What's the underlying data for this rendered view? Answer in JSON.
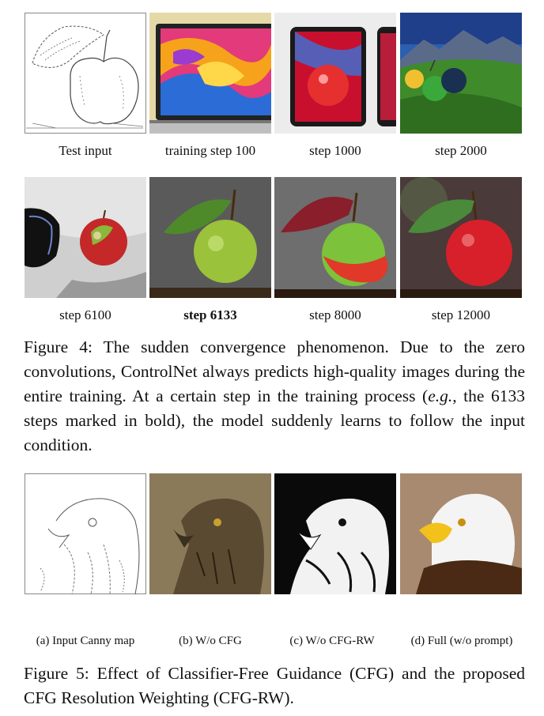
{
  "figure4": {
    "labels": [
      "Test input",
      "training step 100",
      "step 1000",
      "step 2000",
      "step 6100",
      "step 6133",
      "step 8000",
      "step 12000"
    ],
    "caption": {
      "prefix": "Figure 4: The sudden convergence phenomenon. Due to the zero convolutions, ControlNet always predicts high-quality images during the entire training.  At a certain step in the training process (",
      "eg": "e.g.",
      "suffix": ", the 6133 steps marked in bold), the model suddenly learns to follow the input condition."
    }
  },
  "figure5": {
    "labels": [
      "(a) Input Canny map",
      "(b) W/o CFG",
      "(c) W/o CFG-RW",
      "(d) Full (w/o prompt)"
    ],
    "caption": "Figure 5: Effect of Classifier-Free Guidance (CFG) and the proposed CFG Resolution Weighting (CFG-RW)."
  }
}
